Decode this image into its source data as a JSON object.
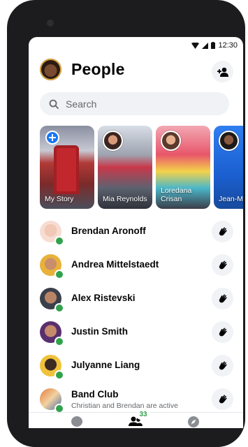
{
  "status_bar": {
    "time": "12:30",
    "icons": [
      "wifi-icon",
      "signal-icon",
      "battery-icon"
    ]
  },
  "header": {
    "title": "People",
    "action_icon": "add-person-icon"
  },
  "search": {
    "placeholder": "Search",
    "value": ""
  },
  "stories": [
    {
      "label": "My Story",
      "own": true
    },
    {
      "label": "Mia Reynolds"
    },
    {
      "label": "Loredana Crisan"
    },
    {
      "label": "Jean-M Denis"
    }
  ],
  "people": [
    {
      "name": "Brendan Aronoff",
      "subtitle": "",
      "online": true,
      "action_icon": "wave-icon"
    },
    {
      "name": "Andrea Mittelstaedt",
      "subtitle": "",
      "online": true,
      "action_icon": "wave-icon"
    },
    {
      "name": "Alex Ristevski",
      "subtitle": "",
      "online": true,
      "action_icon": "wave-icon"
    },
    {
      "name": "Justin Smith",
      "subtitle": "",
      "online": true,
      "action_icon": "wave-icon"
    },
    {
      "name": "Julyanne Liang",
      "subtitle": "",
      "online": true,
      "action_icon": "wave-icon"
    },
    {
      "name": "Band Club",
      "subtitle": "Christian and Brendan are active",
      "online": true,
      "action_icon": "wave-icon"
    }
  ],
  "bottom_nav": {
    "items": [
      {
        "icon": "chat-icon"
      },
      {
        "icon": "people-icon",
        "badge": "33"
      },
      {
        "icon": "discover-icon"
      }
    ]
  },
  "colors": {
    "accent": "#1877f2",
    "online": "#31a24c",
    "surface": "#f0f2f5"
  }
}
